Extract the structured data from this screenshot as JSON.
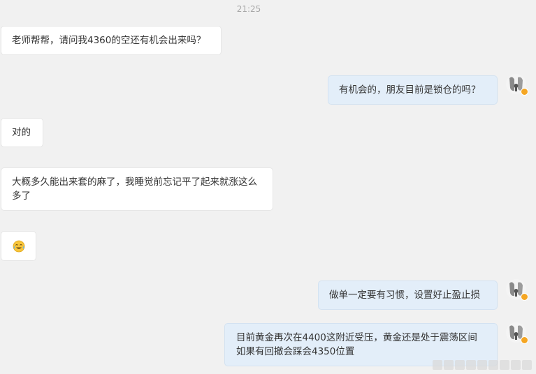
{
  "chat": {
    "timestamp": "21:25",
    "messages": [
      {
        "side": "left",
        "text": "老师帮帮，请问我4360的空还有机会出来吗？"
      },
      {
        "side": "right",
        "text": "有机会的，朋友目前是锁仓的吗？"
      },
      {
        "side": "left",
        "text": "对的"
      },
      {
        "side": "left",
        "text": "大概多久能出来套的麻了，我睡觉前忘记平了起来就涨这么多了"
      },
      {
        "side": "left",
        "emoji": "crying-laughing-emoji"
      },
      {
        "side": "right",
        "text": "做单一定要有习惯，设置好止盈止损"
      },
      {
        "side": "right",
        "text": "目前黄金再次在4400这附近受压，黄金还是处于震荡区间如果有回撤会踩会4350位置"
      }
    ]
  },
  "colors": {
    "background": "#f1f1f1",
    "left_bubble": "#ffffff",
    "right_bubble": "#e3eef9",
    "verified_badge": "#f5a623"
  }
}
